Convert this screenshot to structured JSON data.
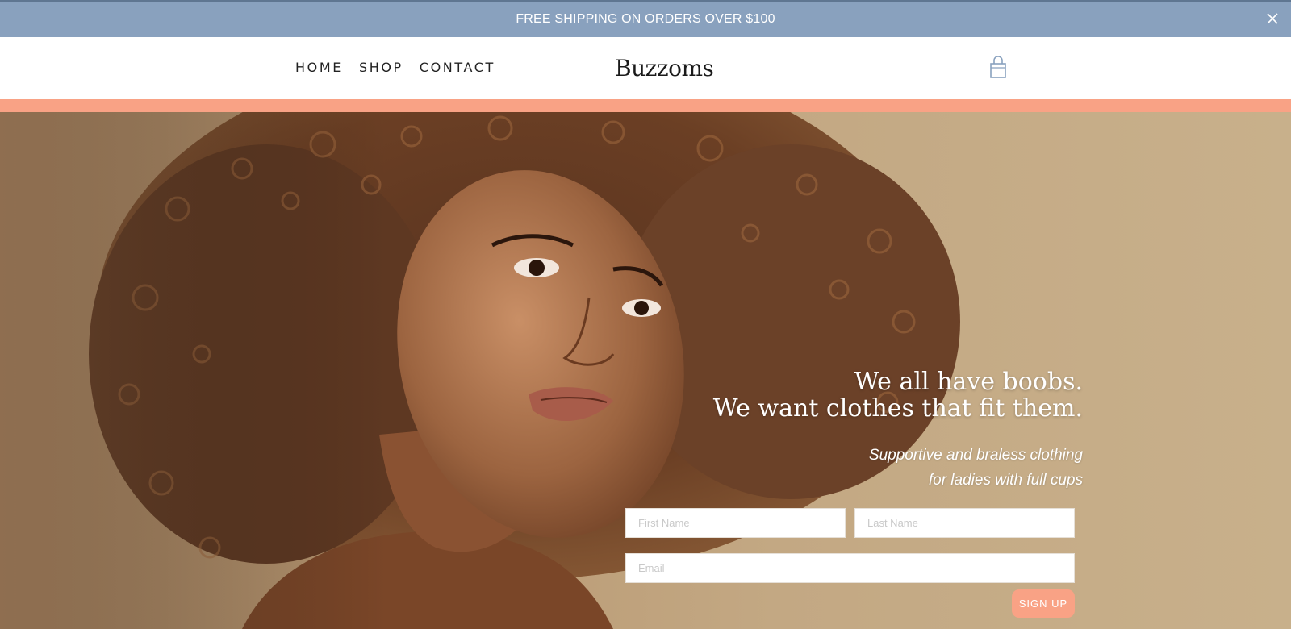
{
  "announcement": {
    "text": "FREE SHIPPING ON ORDERS OVER $100"
  },
  "nav": {
    "items": [
      {
        "label": "HOME"
      },
      {
        "label": "SHOP"
      },
      {
        "label": "CONTACT"
      }
    ]
  },
  "brand": {
    "logo_text": "Buzzoms"
  },
  "hero": {
    "headline_line1": "We all have boobs.",
    "headline_line2": "We want clothes that fit them.",
    "subhead_line1": "Supportive and braless clothing",
    "subhead_line2": "for ladies with full cups"
  },
  "form": {
    "first_name_placeholder": "First Name",
    "last_name_placeholder": "Last Name",
    "email_placeholder": "Email",
    "submit_label": "SIGN UP"
  },
  "colors": {
    "announcement_bg": "#89a1be",
    "accent": "#f9a285",
    "cart_icon": "#89a1be"
  },
  "icons": {
    "close": "close-icon",
    "cart": "shopping-bag-icon"
  }
}
